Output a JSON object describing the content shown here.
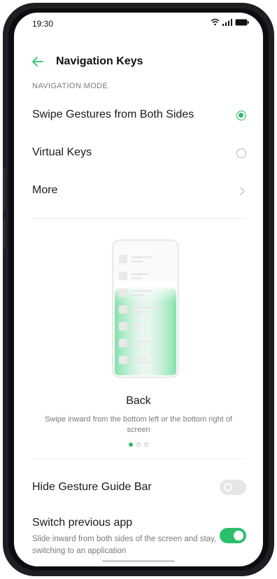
{
  "status_bar": {
    "time": "19:30"
  },
  "header": {
    "title": "Navigation Keys"
  },
  "navigation_mode": {
    "section_label": "NAVIGATION MODE",
    "options": [
      {
        "label": "Swipe Gestures from Both Sides",
        "selected": true
      },
      {
        "label": "Virtual Keys",
        "selected": false
      }
    ],
    "more_label": "More"
  },
  "guide": {
    "title": "Back",
    "description": "Swipe inward from the bottom left or the bottom right of screen",
    "pages": 3,
    "current_page": 1
  },
  "settings": {
    "hide_bar": {
      "label": "Hide Gesture Guide Bar",
      "enabled": false
    },
    "switch_app": {
      "label": "Switch previous app",
      "description": "Slide inward from both sides of the screen and stay, switching to an application",
      "enabled": true
    }
  },
  "colors": {
    "accent": "#2dbe6c",
    "text": "#1a1a1a",
    "secondary_text": "#7a7a7a"
  }
}
